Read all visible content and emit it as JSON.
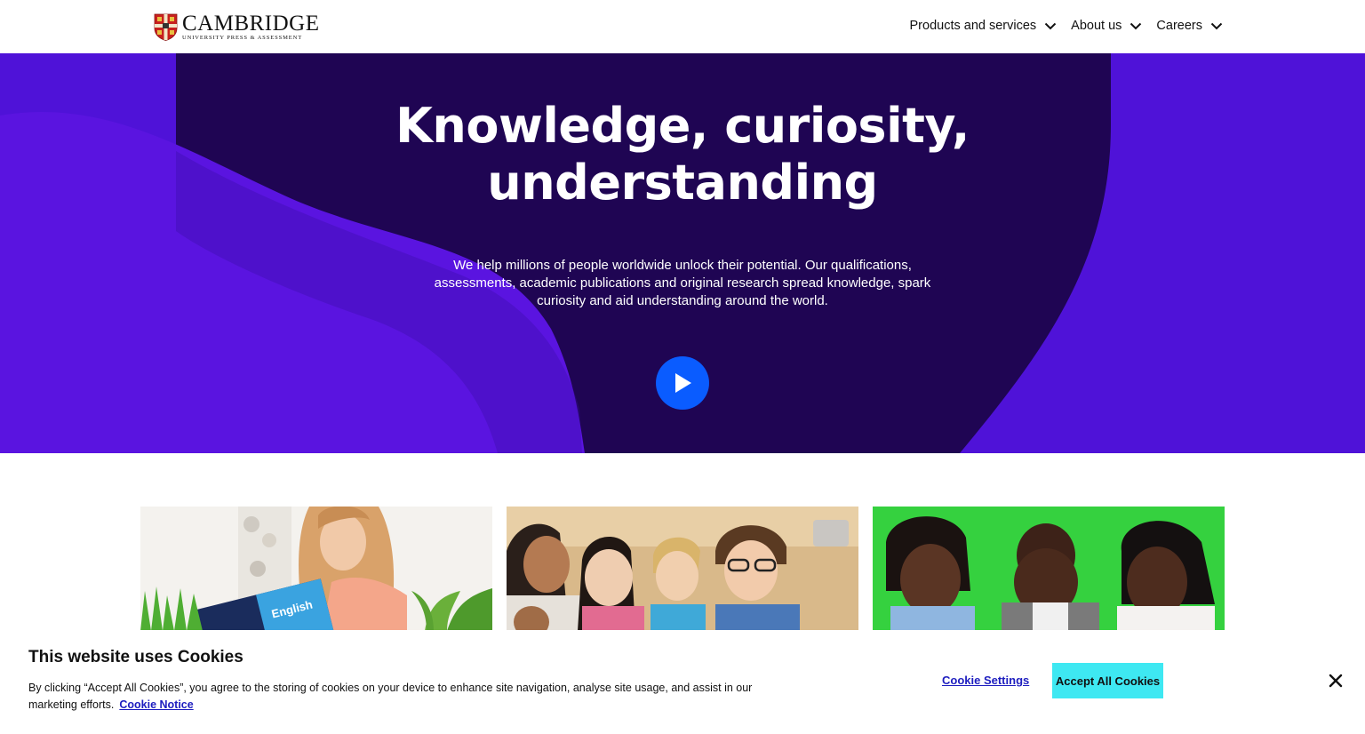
{
  "header": {
    "logo_main": "CAMBRIDGE",
    "logo_sub": "UNIVERSITY PRESS & ASSESSMENT",
    "nav": [
      {
        "label": "Products and services",
        "icon": "chevron-down-icon"
      },
      {
        "label": "About us",
        "icon": "chevron-down-icon"
      },
      {
        "label": "Careers",
        "icon": "chevron-down-icon"
      }
    ]
  },
  "hero": {
    "title_line1": "Knowledge, curiosity,",
    "title_line2": "understanding",
    "description": "We help millions of people worldwide unlock their potential. Our qualifications, assessments, academic publications and original research spread knowledge, spark curiosity and aid understanding around the world.",
    "play_icon": "play-icon",
    "colors": {
      "dark": "#1f0553",
      "mid": "#3a0ca3",
      "bright": "#5a14e0",
      "play": "#0a5cff"
    }
  },
  "cards": [
    {
      "name": "card-english-learner",
      "book_text": "English"
    },
    {
      "name": "card-students-group"
    },
    {
      "name": "card-children-reading"
    }
  ],
  "cookie": {
    "title": "This website uses Cookies",
    "text": "By clicking “Accept All Cookies”, you agree to the storing of cookies on your device to enhance site navigation, analyse site usage, and assist in our marketing efforts.",
    "notice_link": "Cookie Notice",
    "settings_label": "Cookie Settings",
    "accept_label": "Accept All Cookies",
    "accent": "#3ee8f2"
  }
}
